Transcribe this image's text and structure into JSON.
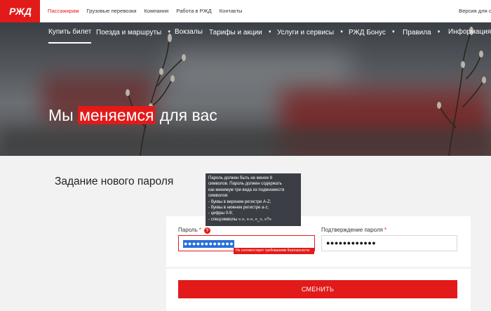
{
  "topbar": {
    "logo_text": "РЖД",
    "links": [
      {
        "label": "Пассажирам",
        "active": true
      },
      {
        "label": "Грузовые перевозки",
        "active": false
      },
      {
        "label": "Компания",
        "active": false
      },
      {
        "label": "Работа в РЖД",
        "active": false
      },
      {
        "label": "Контакты",
        "active": false
      }
    ],
    "version_link": "Версия для сл"
  },
  "nav": {
    "items": [
      {
        "label": "Купить билет",
        "dropdown": false,
        "active": true
      },
      {
        "label": "Поезда и маршруты",
        "dropdown": true
      },
      {
        "label": "Вокзалы",
        "dropdown": false
      },
      {
        "label": "Тарифы и акции",
        "dropdown": true
      },
      {
        "label": "Услуги и сервисы",
        "dropdown": true
      },
      {
        "label": "РЖД Бонус",
        "dropdown": true
      },
      {
        "label": "Правила",
        "dropdown": true
      },
      {
        "label": "Информация",
        "dropdown": false
      }
    ]
  },
  "hero": {
    "headline_before": "Мы ",
    "headline_highlight": "меняемся",
    "headline_after": " для вас"
  },
  "form": {
    "title": "Задание нового пароля",
    "password_label": "Пароль",
    "password_required": "*",
    "help_icon": "?",
    "password_value": "●●●●●●●●●●●●",
    "password_error": "Не соответствует требованиям безопасности",
    "confirm_label": "Подтверждение пароля",
    "confirm_required": "*",
    "confirm_value": "●●●●●●●●●●●●",
    "submit_label": "СМЕНИТЬ"
  },
  "tooltip": {
    "lines": [
      "Пароль должен быть не менее 8",
      "символов. Пароль должен содержать",
      "как минимум три вида из подмножеств",
      "символов:",
      "- буквы в верхнем регистре A-Z;",
      "- буквы в нижнем регистре a-z;",
      "- цифры 0-9;",
      "- спецсимволы «.», «-», «_», «?»"
    ]
  },
  "colors": {
    "brand_red": "#e21a1a",
    "tooltip_bg": "#3b3f45",
    "selection_blue": "#2a6fd6"
  }
}
